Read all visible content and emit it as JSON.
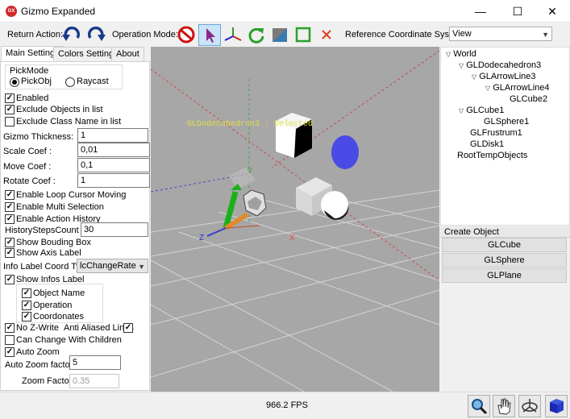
{
  "window": {
    "title": "Gizmo Expanded",
    "icon_text": "GX",
    "minimize": "—",
    "maximize": "☐",
    "close": "✕"
  },
  "toolbar": {
    "return_action_label": "Return Action:",
    "operation_mode_label": "Operation Mode:",
    "ref_coord_label": "Reference Coordinate System",
    "ref_coord_value": "View"
  },
  "tabs": [
    "Main Settings",
    "Colors Settings",
    "About"
  ],
  "main_settings": {
    "pickmode_label": "PickMode",
    "pickobj": "PickObj",
    "raycast": "Raycast",
    "enabled": "Enabled",
    "exclude_objects": "Exclude Objects in list",
    "exclude_class": "Exclude Class Name in list",
    "gizmo_thickness_label": "Gizmo Thickness:",
    "gizmo_thickness": "1",
    "scale_coef_label": "Scale Coef :",
    "scale_coef": "0,01",
    "move_coef_label": "Move Coef :",
    "move_coef": "0,1",
    "rotate_coef_label": "Rotate Coef :",
    "rotate_coef": "1",
    "loop_cursor": "Enable Loop Cursor Moving",
    "multi_selection": "Enable Multi Selection",
    "action_history": "Enable Action History",
    "history_steps_label": "HistoryStepsCount :",
    "history_steps": "30",
    "show_bouding": "Show Bouding Box",
    "show_axis": "Show Axis Label",
    "info_coord_label": "Info Label Coord Typ",
    "info_coord_value": "lcChangeRate",
    "show_infos": "Show Infos Label",
    "object_name": "Object Name",
    "operation": "Operation",
    "coordonates": "Coordonates",
    "no_zwrite": "No Z-Write",
    "anti_aliased": "Anti Aliased Lines",
    "can_change_children": "Can Change With Children",
    "auto_zoom": "Auto Zoom",
    "auto_zoom_factor_label": "Auto Zoom factor",
    "auto_zoom_factor": "5",
    "zoom_factor_label": "Zoom Factor",
    "zoom_factor": "0.35"
  },
  "viewport": {
    "object_label": "GLDodecahedron3 : Selected",
    "axis_z": "Z",
    "axis_x": "X",
    "axis_y": "Y"
  },
  "tree": [
    {
      "label": "World",
      "depth": 0,
      "expander": "▽"
    },
    {
      "label": "GLDodecahedron3",
      "depth": 1,
      "expander": "▽"
    },
    {
      "label": "GLArrowLine3",
      "depth": 2,
      "expander": "▽"
    },
    {
      "label": "GLArrowLine4",
      "depth": 3,
      "expander": "▽"
    },
    {
      "label": "GLCube2",
      "depth": 4,
      "expander": ""
    },
    {
      "label": "GLCube1",
      "depth": 1,
      "expander": "▽"
    },
    {
      "label": "GLSphere1",
      "depth": 2,
      "expander": ""
    },
    {
      "label": "GLFrustrum1",
      "depth": 1,
      "expander": ""
    },
    {
      "label": "GLDisk1",
      "depth": 1,
      "expander": ""
    },
    {
      "label": "RootTempObjects",
      "depth": 0,
      "expander": ""
    }
  ],
  "create_object": {
    "title": "Create Object",
    "buttons": [
      "GLCube",
      "GLSphere",
      "GLPlane"
    ]
  },
  "status": {
    "fps": "966.2 FPS"
  },
  "colors": {
    "titlebar": "#ffffff",
    "viewport_bg": "#a7a7a7",
    "selection_blue": "#cce4f7",
    "disk": "#4a4ae6"
  }
}
